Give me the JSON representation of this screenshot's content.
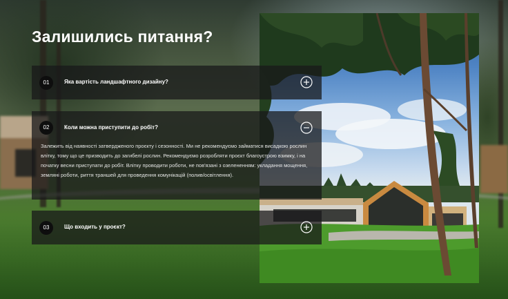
{
  "heading": "Залишились питання?",
  "faq": {
    "items": [
      {
        "number": "01",
        "question": "Яка вартість ландшафтного дизайну?",
        "expanded": false,
        "toggle_icon": "plus-circle-icon"
      },
      {
        "number": "02",
        "question": "Коли можна приступити до робіт?",
        "expanded": true,
        "toggle_icon": "minus-circle-icon",
        "answer": "Залежить від наявності затвердженого проєкту і сезонності. Ми не рекомендуємо займатися висадкою рослин влітку, тому що це призводить до загибелі рослин. Рекомендуємо розробляти проєкт благоустрою взимку, і на початку весни приступати до робіт. Влітку проводити роботи, не пов'язані з озелененням: укладання мощення, земляні роботи, риття траншей для проведення комунікацій (полив/освітлення)."
      },
      {
        "number": "03",
        "question": "Що входить у проєкт?",
        "expanded": false,
        "toggle_icon": "plus-circle-icon"
      }
    ]
  },
  "colors": {
    "panel_bg": "rgba(24,24,26,0.74)",
    "number_badge_bg": "#0e0e0e",
    "text": "#ffffff"
  }
}
